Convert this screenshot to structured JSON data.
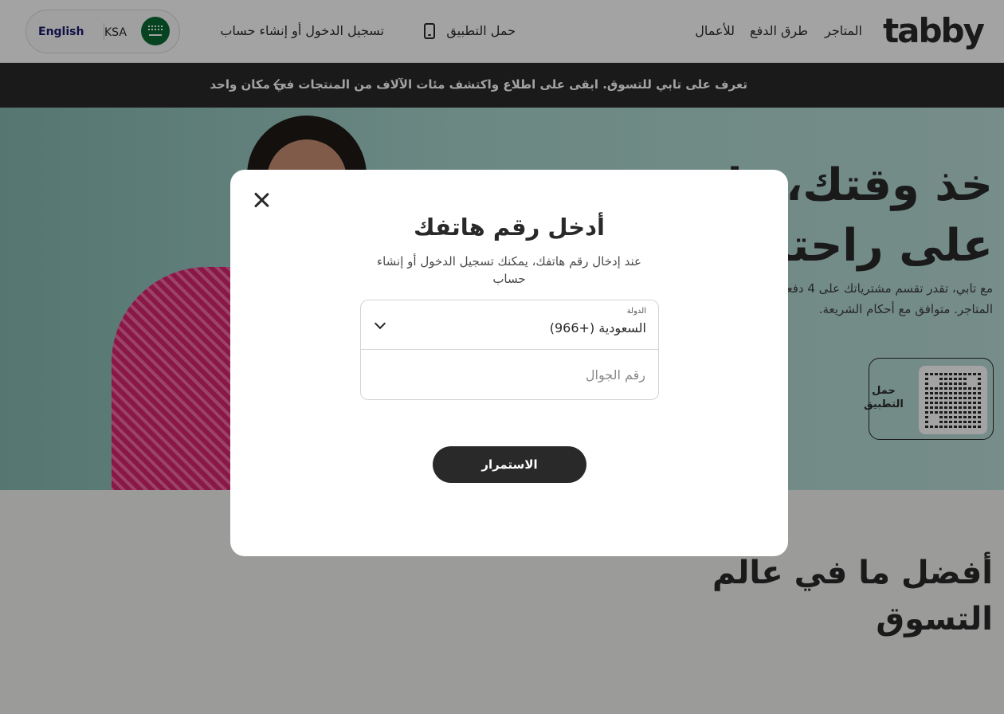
{
  "header": {
    "logo": "tabby",
    "nav": {
      "stores": "المتاجر",
      "payment_methods": "طرق الدفع",
      "business": "للأعمال",
      "download_app": "حمل التطبيق",
      "login": "تسجيل الدخول أو إنشاء حساب"
    },
    "locale": {
      "country": "KSA",
      "language": "English"
    }
  },
  "announcement": {
    "text": "تعرف على تابي للتسوق. ابقى على اطلاع واكتشف مئات الآلاف من المنتجات في مكان واحد"
  },
  "hero": {
    "title_line1": "خذ وقتك، وادفع",
    "title_line2": "على راحتك",
    "subtitle_line1": "مع تابي، تقدر تقسم مشترياتك على 4 دفعات",
    "subtitle_line2": "المتاجر. متوافق مع أحكام الشريعة.",
    "qr_label": "حمل التطبيق"
  },
  "lower": {
    "title_line1": "أفضل ما في عالم",
    "title_line2": "التسوق"
  },
  "modal": {
    "title": "أدخل رقم هاتفك",
    "description": "عند إدخال رقم هاتفك، يمكنك تسجيل الدخول أو إنشاء حساب",
    "country_label": "الدولة",
    "country_value": "السعودية (+966)",
    "phone_placeholder": "رقم الجوال",
    "continue_label": "الاستمرار"
  },
  "colors": {
    "primary_dark": "#292929",
    "hero_teal": "#a8d5cd",
    "flag_green": "#0a6b35"
  }
}
